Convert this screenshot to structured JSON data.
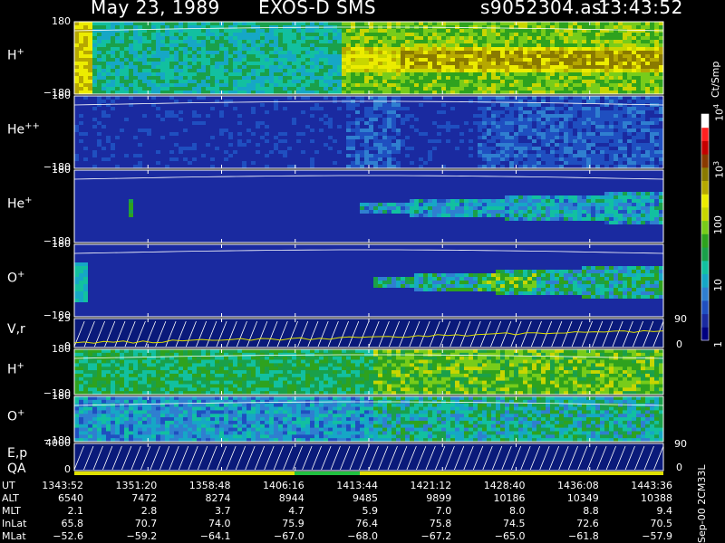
{
  "header": {
    "date": "May 23, 1989",
    "instrument": "EXOS-D SMS",
    "file": "s9052304.asr",
    "time": "13:43:52"
  },
  "colorbar": {
    "unit": "Ct/Smp",
    "tick_labels": [
      "1",
      "10",
      "100",
      "10",
      "10"
    ],
    "tick_exponents": [
      "",
      "",
      "",
      "3",
      "4"
    ],
    "tick_values": [
      1,
      10,
      100,
      1000,
      10000
    ],
    "colors": [
      "#000080",
      "#1a2aa0",
      "#1f4fc0",
      "#2f7fd0",
      "#16a7c6",
      "#12c0a0",
      "#1aa04a",
      "#2ea21e",
      "#78cc1a",
      "#c8d600",
      "#ecec00",
      "#b6a800",
      "#8a7a00",
      "#8a3a00",
      "#c40000",
      "#ff2020",
      "#ffffff"
    ]
  },
  "panels": [
    {
      "id": "h-plus-1",
      "label": "H",
      "sup": "+",
      "ytop": "180",
      "ybot": "−180"
    },
    {
      "id": "he-plusplus",
      "label": "He",
      "sup": "++",
      "ytop": "180",
      "ybot": "−180"
    },
    {
      "id": "he-plus",
      "label": "He",
      "sup": "+",
      "ytop": "180",
      "ybot": "−180"
    },
    {
      "id": "o-plus-1",
      "label": "O",
      "sup": "+",
      "ytop": "180",
      "ybot": "−180"
    },
    {
      "id": "vr",
      "label": "V,r",
      "sup": "",
      "ytop": "25",
      "ybot": "0",
      "rtop": "90",
      "rbot": "0"
    },
    {
      "id": "h-plus-2",
      "label": "H",
      "sup": "+",
      "ytop": "180",
      "ybot": "−180"
    },
    {
      "id": "o-plus-2",
      "label": "O",
      "sup": "+",
      "ytop": "180",
      "ybot": "−180"
    },
    {
      "id": "ep",
      "label": "E,p",
      "sup": "",
      "ytop": "4000",
      "ybot": "0",
      "rtop": "90",
      "rbot": "0"
    }
  ],
  "qa_label": "QA",
  "side_note": "Sep-00 2CM33L",
  "orbit_table": {
    "rows": [
      {
        "name": "UT",
        "values": [
          "1343:52",
          "1351:20",
          "1358:48",
          "1406:16",
          "1413:44",
          "1421:12",
          "1428:40",
          "1436:08",
          "1443:36"
        ]
      },
      {
        "name": "ALT",
        "values": [
          "6540",
          "7472",
          "8274",
          "8944",
          "9485",
          "9899",
          "10186",
          "10349",
          "10388"
        ]
      },
      {
        "name": "MLT",
        "values": [
          "2.1",
          "2.8",
          "3.7",
          "4.7",
          "5.9",
          "7.0",
          "8.0",
          "8.8",
          "9.4"
        ]
      },
      {
        "name": "InLat",
        "values": [
          "65.8",
          "70.7",
          "74.0",
          "75.9",
          "76.4",
          "75.8",
          "74.5",
          "72.6",
          "70.5"
        ]
      },
      {
        "name": "MLat",
        "values": [
          "−52.6",
          "−59.2",
          "−64.1",
          "−67.0",
          "−68.0",
          "−67.2",
          "−65.0",
          "−61.8",
          "−57.9"
        ]
      }
    ]
  },
  "chart_data": {
    "type": "heatmap",
    "title": "May 23, 1989   EXOS-D SMS",
    "x_ticks": [
      "1343:52",
      "1351:20",
      "1358:48",
      "1406:16",
      "1413:44",
      "1421:12",
      "1428:40",
      "1436:08",
      "1443:36"
    ],
    "colorbar_unit": "Ct/Smp",
    "colorbar_range": [
      1,
      10000
    ],
    "colorbar_scale": "log",
    "series": [
      {
        "name": "H+",
        "ylim": [
          -180,
          180
        ]
      },
      {
        "name": "He++",
        "ylim": [
          -180,
          180
        ]
      },
      {
        "name": "He+",
        "ylim": [
          -180,
          180
        ]
      },
      {
        "name": "O+",
        "ylim": [
          -180,
          180
        ]
      },
      {
        "name": "V,r",
        "ylim": [
          0,
          25
        ]
      },
      {
        "name": "H+",
        "ylim": [
          -180,
          180
        ]
      },
      {
        "name": "O+",
        "ylim": [
          -180,
          180
        ]
      },
      {
        "name": "E,p",
        "ylim": [
          0,
          4000
        ]
      }
    ]
  }
}
